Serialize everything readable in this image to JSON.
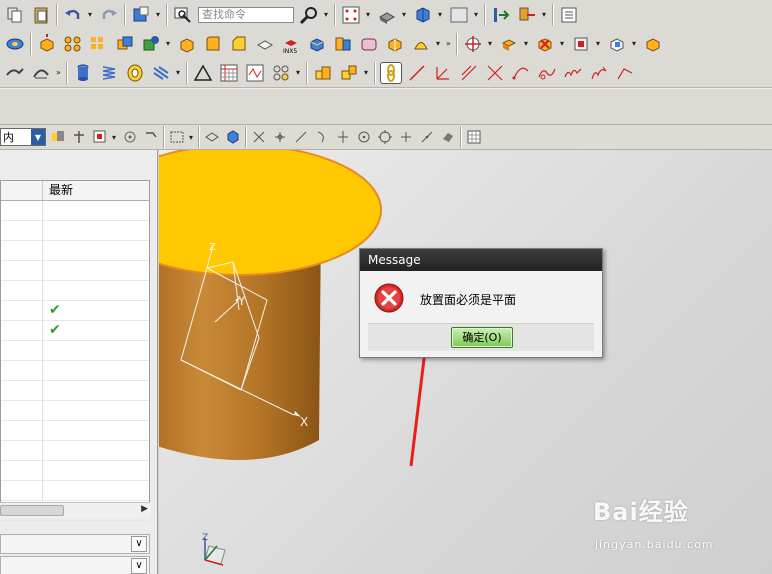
{
  "toolbar": {
    "search_placeholder": "查找命令",
    "arrow_glyph": "▾",
    "more_glyph": "»"
  },
  "selection_bar": {
    "filter_value": "内",
    "filter_arrow": "▼"
  },
  "navigator": {
    "column_latest": "最新",
    "rows": [
      "",
      "",
      "",
      "",
      "",
      "✔",
      "✔",
      "",
      "",
      "",
      "",
      "",
      "",
      "",
      "",
      ""
    ],
    "scroll_right": "▶",
    "chevron": "∨"
  },
  "viewport": {
    "csys_labels": [
      "Z",
      "Y",
      "X"
    ],
    "small_csys_label": "Z",
    "part_top_color": "#ffc800",
    "part_side_color": "#c8822e",
    "arrow_color": "#e8201c"
  },
  "dialog": {
    "title": "Message",
    "message": "放置面必须是平面",
    "ok_label": "确定(O)"
  },
  "watermark": {
    "brand": "Bai经验",
    "url": "jingyan.baidu.com"
  }
}
